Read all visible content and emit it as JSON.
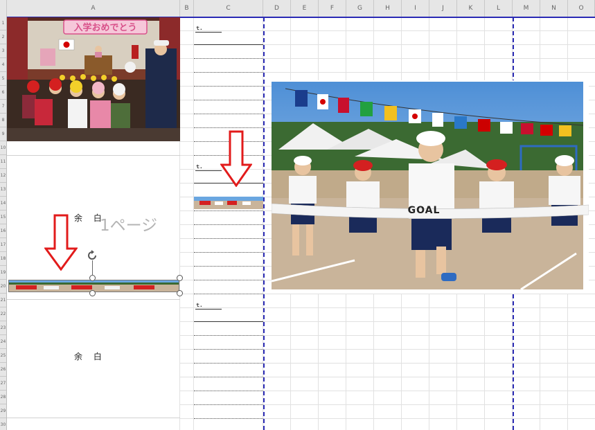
{
  "columns": [
    "A",
    "B",
    "C",
    "D",
    "E",
    "F",
    "G",
    "H",
    "I",
    "J",
    "K",
    "L",
    "M",
    "N",
    "O"
  ],
  "rows": [
    "1",
    "2",
    "3",
    "4",
    "5",
    "6",
    "7",
    "8",
    "9",
    "10",
    "11",
    "12",
    "13",
    "14",
    "15",
    "16",
    "17",
    "18",
    "19",
    "20",
    "21",
    "22",
    "23",
    "24",
    "25",
    "26",
    "27",
    "28",
    "29",
    "30"
  ],
  "photo_entrance": {
    "banner_text": "入学おめでとう"
  },
  "photo_sports": {
    "goal_text": "GOAL"
  },
  "cells": {
    "margin_label_1": "余　 白",
    "margin_label_2": "余　 白",
    "page_watermark": "1ページ",
    "small_mark_1": "ｔ.",
    "small_mark_2": "ｔ.",
    "small_mark_3": "ｔ."
  },
  "colors": {
    "page_break": "#2a2ab4",
    "arrow": "#e21b1b",
    "sky": "#6aa6e0"
  }
}
